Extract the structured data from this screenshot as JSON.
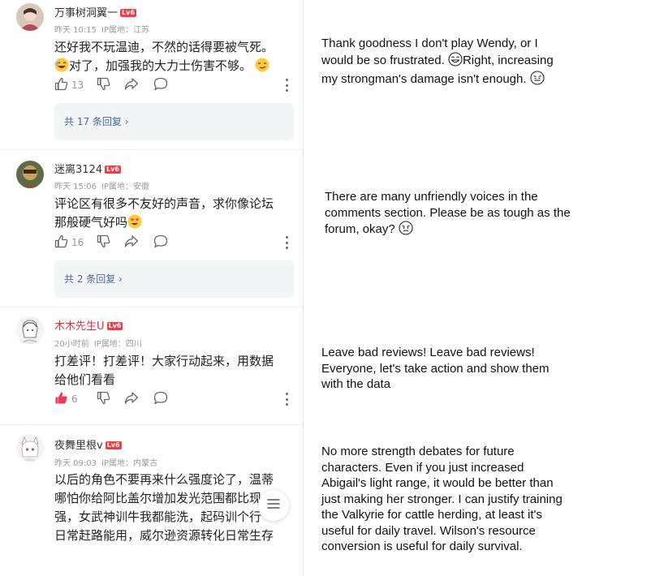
{
  "comments": [
    {
      "username": "万事树洞翼一",
      "username_red": false,
      "level": "Lv6",
      "time": "昨天 10:15",
      "ip": "IP属地：江苏",
      "text_line1": "还好我不玩温迪，不然的话得要被气死。",
      "text_line2": "对了，加强我的大力士伤害不够。",
      "likes": "13",
      "liked": false,
      "replies": "共 17 条回复 ›",
      "translation_before": "Thank goodness I don't play Wendy, or I would be so frustrated.",
      "translation_mid": "Right, increasing my strongman's damage isn't enough."
    },
    {
      "username": "迷离3124",
      "username_red": false,
      "level": "Lv6",
      "time": "昨天 15:06",
      "ip": "IP属地：安徽",
      "text_line1": "评论区有很多不友好的声音，求你像论坛",
      "text_line2": "那般硬气好吗",
      "likes": "16",
      "liked": false,
      "replies": "共 2 条回复 ›",
      "translation": "There are many unfriendly voices in the comments section. Please be as tough as the forum, okay?"
    },
    {
      "username": "木木先生U",
      "username_red": true,
      "level": "Lv6",
      "time": "20小时前",
      "ip": "IP属地：四川",
      "text_line1": "打差评！打差评！大家行动起来，用数据",
      "text_line2": "给他们看看",
      "likes": "6",
      "liked": true,
      "translation": "Leave bad reviews! Leave bad reviews! Everyone, let's take action and show them with the data"
    },
    {
      "username": "夜舞里根v",
      "username_red": false,
      "level": "Lv6",
      "time": "昨天 09:03",
      "ip": "IP属地：内蒙古",
      "text_line1": "以后的角色不要再来什么强度论了，温蒂",
      "text_line2": "哪怕你给阿比盖尔增加发光范围都比现",
      "text_line3": "强，女武神训牛我都能洗，起码训个行",
      "text_line4": "日常赶路能用，威尔逊资源转化日常生存",
      "translation": "No more strength debates for future characters. Even if you just increased Abigail's light range, it would be better than just making her stronger. I can justify training the Valkyrie for cattle herding, at least it's useful for daily travel. Wilson's resource conversion is useful for daily survival."
    }
  ],
  "colors": {
    "accent_red": "#e0343b",
    "like_active": "#ee3b5a",
    "reply_link": "#4b6b9b"
  }
}
